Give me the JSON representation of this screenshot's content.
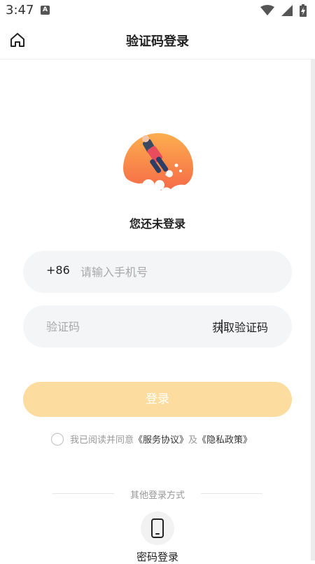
{
  "status_bar": {
    "time": "3:47",
    "app_icon_letter": "A"
  },
  "nav": {
    "title": "验证码登录"
  },
  "hero": {
    "subtitle": "您还未登录"
  },
  "phone": {
    "prefix": "+86",
    "placeholder": "请输入手机号",
    "value": ""
  },
  "code": {
    "placeholder": "验证码",
    "value": "",
    "get_code_label": "获取验证码"
  },
  "login_button": {
    "label": "登录"
  },
  "agreement": {
    "prefix_text": "我已阅读并同意",
    "terms_link": "《服务协议》",
    "and_text": "及",
    "privacy_link": "《隐私政策》",
    "checked": false
  },
  "other_methods": {
    "label": "其他登录方式",
    "password_login_label": "密码登录"
  },
  "colors": {
    "accent": "#fcdc9f",
    "illustration": "#f98a4b"
  }
}
